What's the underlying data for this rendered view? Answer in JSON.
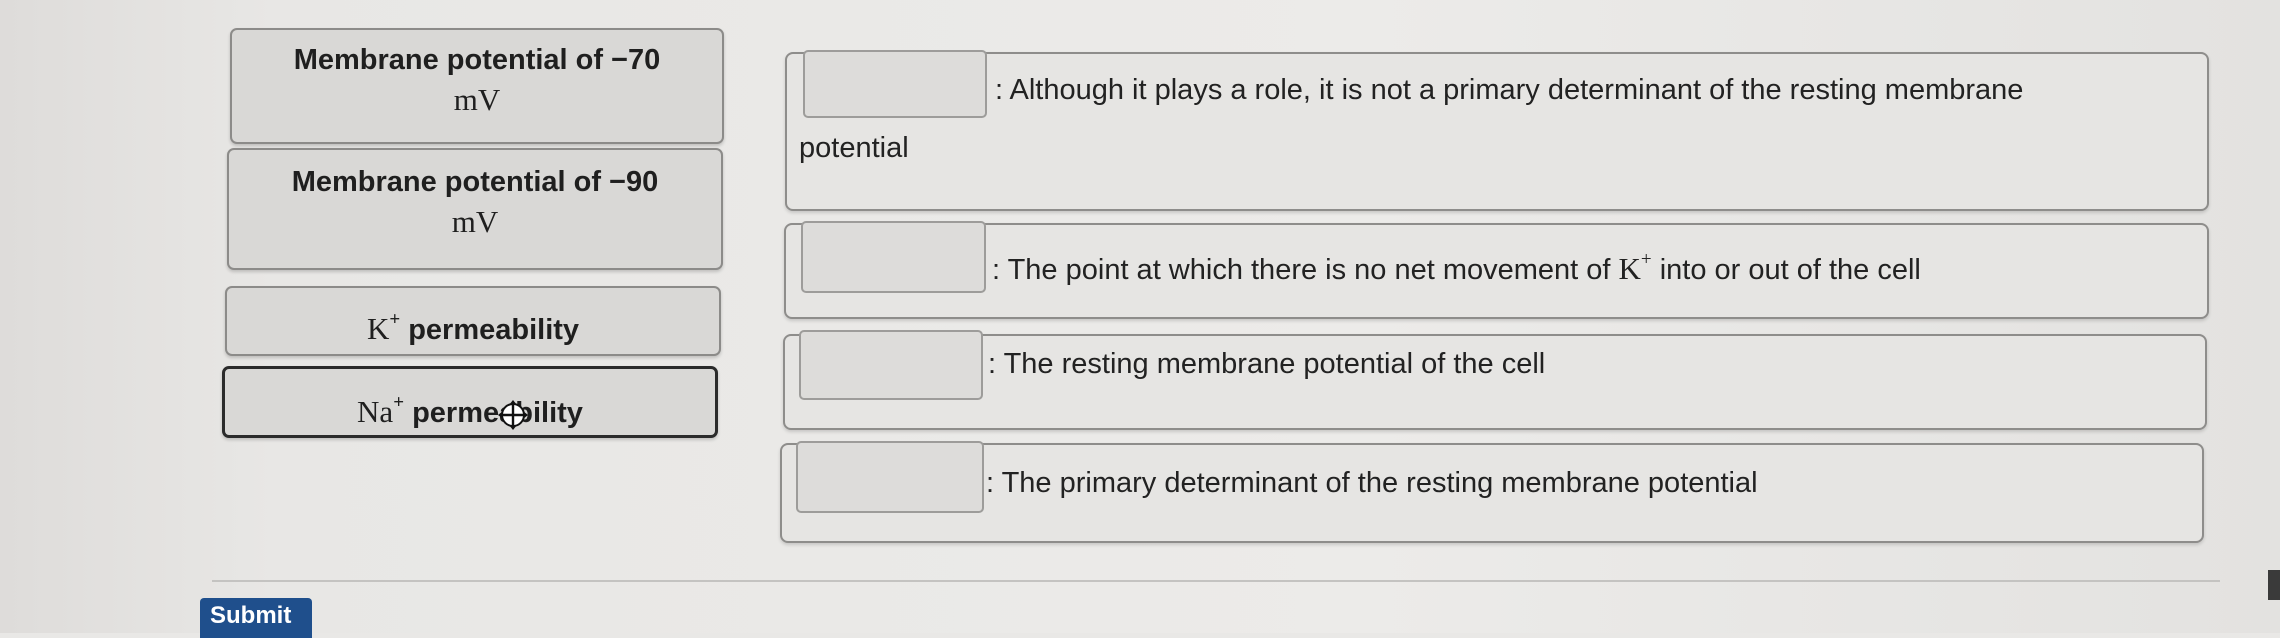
{
  "choices": [
    {
      "line1": "Membrane potential of −70",
      "line2": "mV"
    },
    {
      "line1": "Membrane potential of −90",
      "line2": "mV"
    },
    {
      "base": "K",
      "sup": "+",
      "label": "permeability"
    },
    {
      "base": "Na",
      "sup": "+",
      "label": "permeability"
    }
  ],
  "targets": [
    {
      "text_line1": ": Although it plays a role, it is not a primary determinant of the resting membrane",
      "text_line2": "potential"
    },
    {
      "text_before": ": The point at which there is no net movement of ",
      "ion_base": "K",
      "ion_sup": "+",
      "text_after": " into or out of the cell"
    },
    {
      "text": ": The resting membrane potential of the cell"
    },
    {
      "text": ": The primary determinant of the resting membrane potential"
    }
  ],
  "submit_label": "Submit",
  "icons": {
    "cursor": "move-cursor-icon"
  }
}
